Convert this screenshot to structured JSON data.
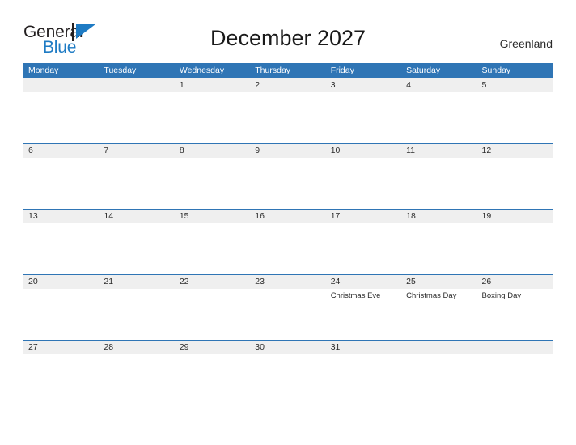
{
  "brand": {
    "name_part1": "General",
    "name_part2": "Blue",
    "mark_icon": "flag-triangle-icon",
    "color_dark": "#231f20",
    "color_blue": "#1e7bc4"
  },
  "header": {
    "title": "December 2027",
    "locale": "Greenland"
  },
  "theme": {
    "header_blue": "#2f75b5",
    "row_band_gray": "#efefef",
    "text_dark": "#2b2b2b",
    "background": "#ffffff"
  },
  "calendar": {
    "month": "December",
    "year": "2027",
    "week_start": "Monday",
    "day_headers": [
      "Monday",
      "Tuesday",
      "Wednesday",
      "Thursday",
      "Friday",
      "Saturday",
      "Sunday"
    ],
    "weeks": [
      {
        "days": [
          {
            "num": "",
            "event": ""
          },
          {
            "num": "",
            "event": ""
          },
          {
            "num": "1",
            "event": ""
          },
          {
            "num": "2",
            "event": ""
          },
          {
            "num": "3",
            "event": ""
          },
          {
            "num": "4",
            "event": ""
          },
          {
            "num": "5",
            "event": ""
          }
        ]
      },
      {
        "days": [
          {
            "num": "6",
            "event": ""
          },
          {
            "num": "7",
            "event": ""
          },
          {
            "num": "8",
            "event": ""
          },
          {
            "num": "9",
            "event": ""
          },
          {
            "num": "10",
            "event": ""
          },
          {
            "num": "11",
            "event": ""
          },
          {
            "num": "12",
            "event": ""
          }
        ]
      },
      {
        "days": [
          {
            "num": "13",
            "event": ""
          },
          {
            "num": "14",
            "event": ""
          },
          {
            "num": "15",
            "event": ""
          },
          {
            "num": "16",
            "event": ""
          },
          {
            "num": "17",
            "event": ""
          },
          {
            "num": "18",
            "event": ""
          },
          {
            "num": "19",
            "event": ""
          }
        ]
      },
      {
        "days": [
          {
            "num": "20",
            "event": ""
          },
          {
            "num": "21",
            "event": ""
          },
          {
            "num": "22",
            "event": ""
          },
          {
            "num": "23",
            "event": ""
          },
          {
            "num": "24",
            "event": "Christmas Eve"
          },
          {
            "num": "25",
            "event": "Christmas Day"
          },
          {
            "num": "26",
            "event": "Boxing Day"
          }
        ]
      },
      {
        "days": [
          {
            "num": "27",
            "event": ""
          },
          {
            "num": "28",
            "event": ""
          },
          {
            "num": "29",
            "event": ""
          },
          {
            "num": "30",
            "event": ""
          },
          {
            "num": "31",
            "event": ""
          },
          {
            "num": "",
            "event": ""
          },
          {
            "num": "",
            "event": ""
          }
        ]
      }
    ]
  }
}
